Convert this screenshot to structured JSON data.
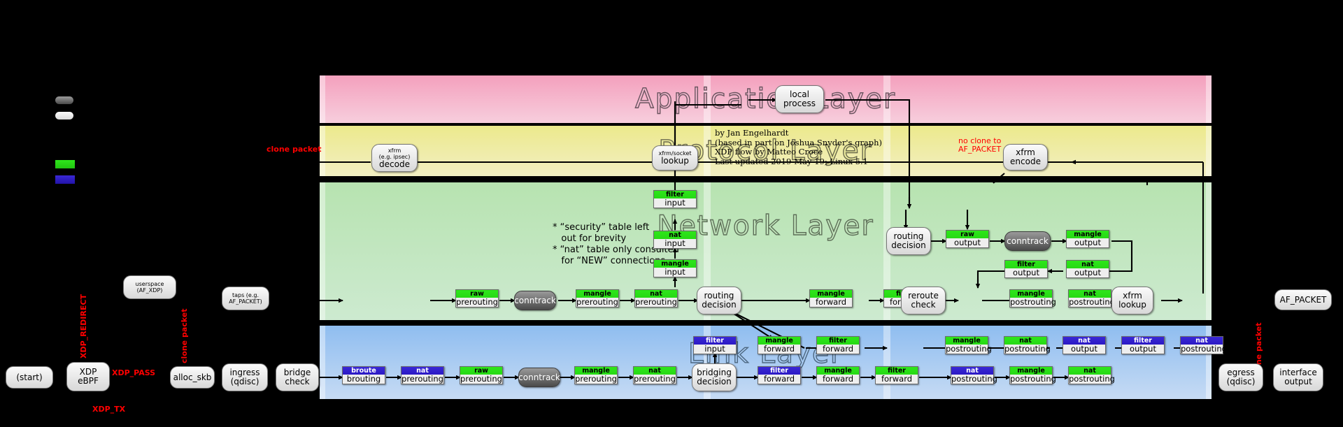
{
  "layers": {
    "application": {
      "title": "Application Layer"
    },
    "protocol": {
      "title": "Protocol Layer"
    },
    "network": {
      "title": "Network Layer"
    },
    "link": {
      "title": "Link Layer"
    }
  },
  "credits": "by Jan Engelhardt\n(based in part on Joshua Snyder's graph)\nXDP flow by Matteo Croce\nLast updated 2019-May-19; Linux 5.1",
  "notes": "* “security” table left\n   out for brevity\n* “nat” table only consulted\n   for “NEW” connections",
  "annotations": {
    "clone_packet_left_proto": "clone packet",
    "clone_packet_left_link": "clone packet",
    "clone_packet_right": "clone packet",
    "no_clone": "no clone to\nAF_PACKET",
    "xdp_redirect": "XDP_REDIRECT",
    "xdp_pass": "XDP_PASS",
    "xdp_tx": "XDP_TX"
  },
  "nodes": {
    "start": "(start)",
    "xdp_ebpf_l1": "XDP",
    "xdp_ebpf_l2": "eBPF",
    "userspace_l1": "userspace",
    "userspace_l2": "(AF_XDP)",
    "alloc_skb": "alloc_skb",
    "taps_l1": "taps (e.g.",
    "taps_l2": "AF_PACKET)",
    "ingress_l1": "ingress",
    "ingress_l2": "(qdisc)",
    "bridge_check_l1": "bridge",
    "bridge_check_l2": "check",
    "conntrack": "conntrack",
    "bridging_decision_l1": "bridging",
    "bridging_decision_l2": "decision",
    "routing_decision_l1": "routing",
    "routing_decision_l2": "decision",
    "reroute_check_l1": "reroute",
    "reroute_check_l2": "check",
    "xfrm_lookup_l1": "xfrm",
    "xfrm_lookup_l2": "lookup",
    "xfrm_socket_lookup_l1": "xfrm/socket",
    "xfrm_socket_lookup_l2": "lookup",
    "xfrm_decode_l1": "xfrm",
    "xfrm_decode_sm": "(e.g. ipsec)",
    "xfrm_decode_l2": "decode",
    "xfrm_encode_l1": "xfrm",
    "xfrm_encode_l2": "encode",
    "local_process_l1": "local",
    "local_process_l2": "process",
    "egress_l1": "egress",
    "egress_l2": "(qdisc)",
    "interface_output_l1": "interface",
    "interface_output_l2": "output",
    "af_packet": "AF_PACKET"
  },
  "chains": {
    "link_in": [
      {
        "table": "broute",
        "chain": "brouting",
        "color": "blue"
      },
      {
        "table": "nat",
        "chain": "prerouting",
        "color": "blue"
      },
      {
        "table": "raw",
        "chain": "prerouting",
        "color": "green"
      },
      {
        "table": "mangle",
        "chain": "prerouting",
        "color": "green"
      },
      {
        "table": "nat",
        "chain": "prerouting",
        "color": "green"
      }
    ],
    "link_filter_input": {
      "table": "filter",
      "chain": "input",
      "color": "blue"
    },
    "link_fwd_lower": [
      {
        "table": "filter",
        "chain": "forward",
        "color": "blue"
      },
      {
        "table": "mangle",
        "chain": "forward",
        "color": "green"
      },
      {
        "table": "filter",
        "chain": "forward",
        "color": "green"
      }
    ],
    "link_fwd_upper": [
      {
        "table": "mangle",
        "chain": "forward",
        "color": "green"
      },
      {
        "table": "filter",
        "chain": "forward",
        "color": "green"
      }
    ],
    "link_post_lower": [
      {
        "table": "nat",
        "chain": "postrouting",
        "color": "blue"
      },
      {
        "table": "mangle",
        "chain": "postrouting",
        "color": "green"
      },
      {
        "table": "nat",
        "chain": "postrouting",
        "color": "green"
      }
    ],
    "link_post_upper": [
      {
        "table": "mangle",
        "chain": "postrouting",
        "color": "green"
      },
      {
        "table": "nat",
        "chain": "postrouting",
        "color": "green"
      },
      {
        "table": "nat",
        "chain": "output",
        "color": "blue"
      },
      {
        "table": "filter",
        "chain": "output",
        "color": "blue"
      },
      {
        "table": "nat",
        "chain": "postrouting",
        "color": "blue"
      }
    ],
    "net_pre": [
      {
        "table": "raw",
        "chain": "prerouting",
        "color": "green"
      },
      {
        "table": "mangle",
        "chain": "prerouting",
        "color": "green"
      },
      {
        "table": "nat",
        "chain": "prerouting",
        "color": "green"
      }
    ],
    "net_input": [
      {
        "table": "mangle",
        "chain": "input",
        "color": "green"
      },
      {
        "table": "nat",
        "chain": "input",
        "color": "green"
      },
      {
        "table": "filter",
        "chain": "input",
        "color": "green"
      }
    ],
    "net_forward": [
      {
        "table": "mangle",
        "chain": "forward",
        "color": "green"
      },
      {
        "table": "filter",
        "chain": "forward",
        "color": "green"
      }
    ],
    "net_output_top": [
      {
        "table": "raw",
        "chain": "output",
        "color": "green"
      },
      {
        "table": "mangle",
        "chain": "output",
        "color": "green"
      }
    ],
    "net_output_bottom": [
      {
        "table": "filter",
        "chain": "output",
        "color": "green"
      },
      {
        "table": "nat",
        "chain": "output",
        "color": "green"
      }
    ],
    "net_post": [
      {
        "table": "mangle",
        "chain": "postrouting",
        "color": "green"
      },
      {
        "table": "nat",
        "chain": "postrouting",
        "color": "green"
      }
    ]
  }
}
